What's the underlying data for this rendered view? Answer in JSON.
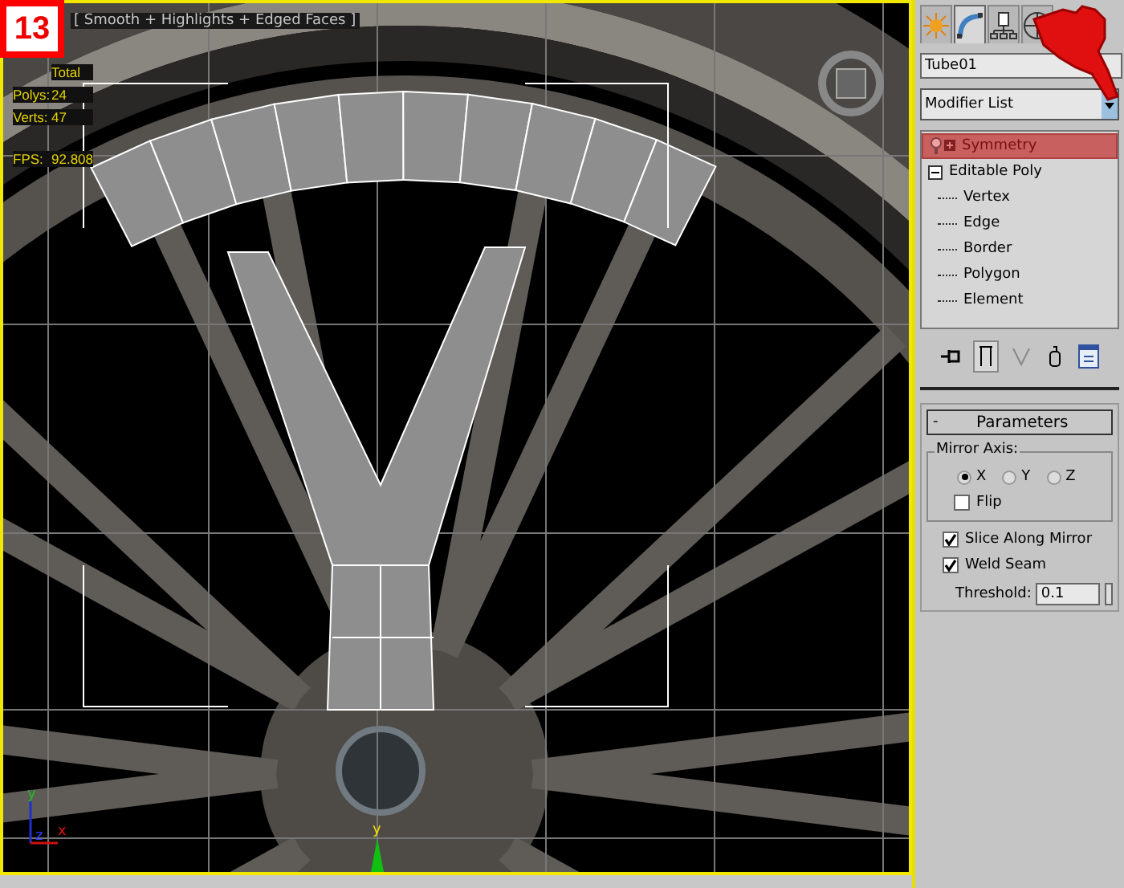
{
  "badge": "13",
  "viewport": {
    "label": "[ Smooth + Highlights + Edged Faces ]",
    "total_label": "Total",
    "stats": [
      {
        "label": "Polys:",
        "value": "24"
      },
      {
        "label": "Verts:",
        "value": "47"
      }
    ],
    "fps": {
      "label": "FPS:",
      "value": "92.808"
    },
    "axes": {
      "y": "y",
      "z": "z",
      "x": "x"
    },
    "gizmo_axis": "y"
  },
  "command_panel": {
    "tabs": [
      {
        "kind": "create",
        "selected": false
      },
      {
        "kind": "modify",
        "selected": true
      },
      {
        "kind": "hierarchy",
        "selected": false
      },
      {
        "kind": "motion",
        "selected": false
      }
    ],
    "object_name": "Tube01",
    "modifier_list": "Modifier List",
    "stack": [
      {
        "label": "Symmetry",
        "selected": true
      },
      {
        "label": "Editable Poly",
        "selected": false,
        "expanded": true,
        "children": [
          {
            "label": "Vertex",
            "selected": false
          },
          {
            "label": "Edge",
            "selected": false
          },
          {
            "label": "Border",
            "selected": false
          },
          {
            "label": "Polygon",
            "selected": false
          },
          {
            "label": "Element",
            "selected": false
          }
        ]
      }
    ],
    "rollout": {
      "title": "Parameters",
      "toggle": "-",
      "mirror_axis": {
        "title": "Mirror Axis:",
        "options": [
          {
            "label": "X",
            "selected": true
          },
          {
            "label": "Y",
            "selected": false
          },
          {
            "label": "Z",
            "selected": false
          }
        ],
        "flip": {
          "label": "Flip",
          "checked": false
        }
      },
      "checkboxes": [
        {
          "label": "Slice Along Mirror",
          "checked": true
        },
        {
          "label": "Weld Seam",
          "checked": true
        }
      ],
      "threshold": {
        "label": "Threshold:",
        "value": "0.1"
      }
    }
  }
}
